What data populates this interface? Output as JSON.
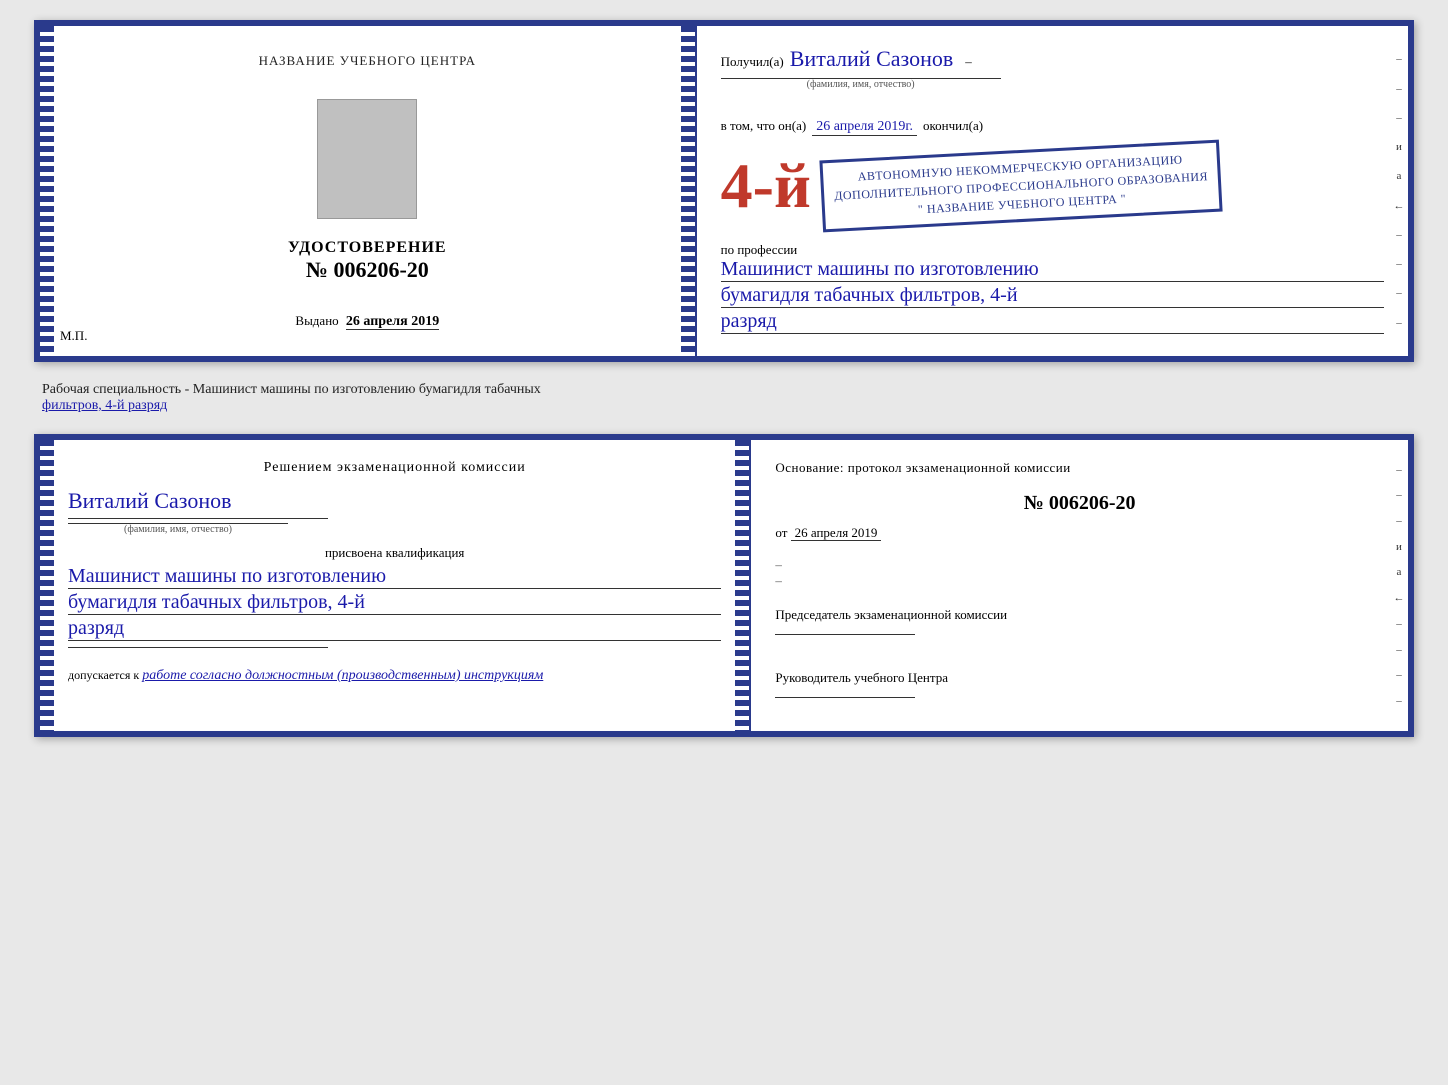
{
  "top_cert": {
    "left": {
      "heading": "НАЗВАНИЕ УЧЕБНОГО ЦЕНТРА",
      "cert_label": "УДОСТОВЕРЕНИЕ",
      "cert_number": "№ 006206-20",
      "issued_label": "Выдано",
      "issued_date": "26 апреля 2019",
      "mp_label": "М.П."
    },
    "right": {
      "получил_label": "Получил(а)",
      "recipient_name": "Виталий Сазонов",
      "recipient_sublabel": "(фамилия, имя, отчество)",
      "vtom_label": "в том, что он(а)",
      "date_value": "26 апреля 2019г.",
      "okончил_label": "окончил(а)",
      "big_number": "4-й",
      "stamp_line1": "АВТОНОМНУЮ НЕКОММЕРЧЕСКУЮ ОРГАНИЗАЦИЮ",
      "stamp_line2": "ДОПОЛНИТЕЛЬНОГО ПРОФЕССИОНАЛЬНОГО ОБРАЗОВАНИЯ",
      "stamp_line3": "\" НАЗВАНИЕ УЧЕБНОГО ЦЕНТРА \"",
      "profession_label": "по профессии",
      "profession_line1": "Машинист машины по изготовлению",
      "profession_line2": "бумагидля табачных фильтров, 4-й",
      "profession_line3": "разряд"
    }
  },
  "middle": {
    "text": "Рабочая специальность - Машинист машины по изготовлению бумагидля табачных",
    "underline_text": "фильтров, 4-й разряд"
  },
  "bottom_cert": {
    "left": {
      "decision_heading": "Решением экзаменационной комиссии",
      "person_name": "Виталий Сазонов",
      "person_sublabel": "(фамилия, имя, отчество)",
      "assigned_label": "присвоена квалификация",
      "qualification_line1": "Машинист машины по изготовлению",
      "qualification_line2": "бумагидля табачных фильтров, 4-й",
      "qualification_line3": "разряд",
      "allowed_label": "допускается к",
      "allowed_value": "работе согласно должностным (производственным) инструкциям"
    },
    "right": {
      "basis_heading": "Основание: протокол экзаменационной комиссии",
      "protocol_num": "№ 006206-20",
      "date_label": "от",
      "date_value": "26 апреля 2019",
      "chairman_label": "Председатель экзаменационной комиссии",
      "director_label": "Руководитель учебного Центра"
    }
  },
  "decorative": {
    "dashes": [
      "-",
      "-",
      "-",
      "и",
      "а",
      "←",
      "-",
      "-",
      "-",
      "-"
    ]
  }
}
